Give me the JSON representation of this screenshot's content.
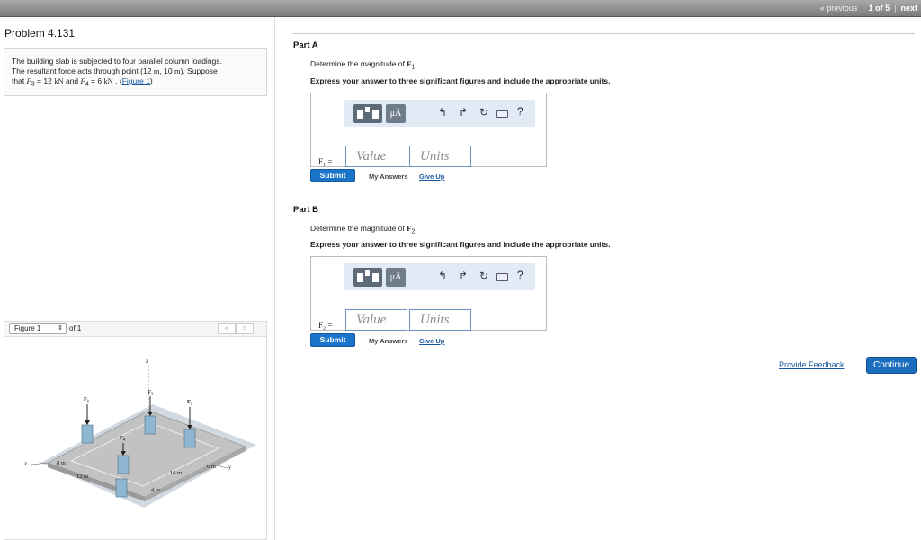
{
  "pager": {
    "previous": "« previous",
    "count": "1 of 5",
    "next": "next"
  },
  "problem": {
    "title": "Problem 4.131",
    "line1": "The building slab is subjected to four parallel column loadings.",
    "line2a": "The resultant force acts through point (12 ",
    "unit_m": "m",
    "line2b": ", 10 ",
    "line2c": "). Suppose",
    "line3a": "that ",
    "f3": "F",
    "f3sub": "3",
    "line3b": " = 12 ",
    "kn": "kN",
    "line3c": " and ",
    "f4": "F",
    "f4sub": "4",
    "line3d": " = 6 ",
    "line3e": " . (",
    "figlink": "Figure 1",
    "line3f": ")"
  },
  "figure": {
    "select": "Figure 1",
    "of": "of 1",
    "prev": "<",
    "next": ">",
    "labels": {
      "z": "z",
      "x": "x",
      "y": "y",
      "f1": "F₁",
      "f2": "F₂",
      "f3": "F₃",
      "f4": "F₄",
      "d8m": "8 m",
      "d12m": "12 m",
      "d16m": "16 m",
      "d6m": "6 m",
      "d4m": "4 m"
    },
    "colors": {
      "slab": "#c2c2c2",
      "ground": "#cdd5dd",
      "column": "#8fb7d2"
    }
  },
  "partA": {
    "head": "Part A",
    "prompt": "Determine the magnitude of ",
    "var": "F",
    "sub": "1",
    "end": ".",
    "instr": "Express your answer to three significant figures and include the appropriate units.",
    "label": "F₁ =",
    "value_ph": "Value",
    "units_ph": "Units",
    "submit": "Submit",
    "myans": "My Answers",
    "giveup": "Give Up"
  },
  "partB": {
    "head": "Part B",
    "prompt": "Determine the magnitude of ",
    "var": "F",
    "sub": "2",
    "end": ".",
    "instr": "Express your answer to three significant figures and include the appropriate units.",
    "label": "F₂ =",
    "value_ph": "Value",
    "units_ph": "Units",
    "submit": "Submit",
    "myans": "My Answers",
    "giveup": "Give Up"
  },
  "toolbar": {
    "mu": "μÅ",
    "undo": "↰",
    "redo": "↱",
    "reset": "↻",
    "help": "?",
    "icons": [
      "templates-icon",
      "units-icon",
      "undo-icon",
      "redo-icon",
      "reset-icon",
      "keyboard-icon",
      "help-icon"
    ]
  },
  "footer": {
    "feedback": "Provide Feedback",
    "continue": "Continue"
  }
}
